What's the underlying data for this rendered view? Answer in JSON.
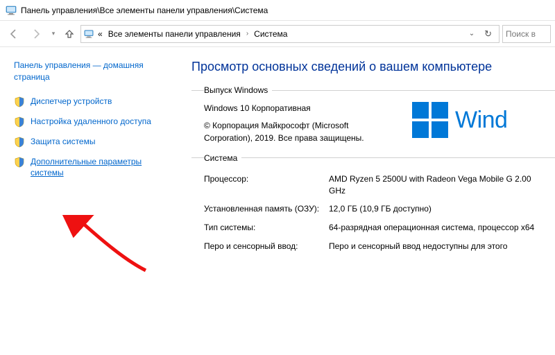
{
  "titlebar": {
    "text": "Панель управления\\Все элементы панели управления\\Система"
  },
  "address": {
    "prefix": "«",
    "crumb1": "Все элементы панели управления",
    "crumb2": "Система"
  },
  "search": {
    "placeholder": "Поиск в"
  },
  "sidebar": {
    "home_label": "Панель управления — домашняя страница",
    "items": [
      {
        "label": "Диспетчер устройств"
      },
      {
        "label": "Настройка удаленного доступа"
      },
      {
        "label": "Защита системы"
      },
      {
        "label": "Дополнительные параметры системы"
      }
    ]
  },
  "main": {
    "heading": "Просмотр основных сведений о вашем компьютере",
    "windows_group_legend": "Выпуск Windows",
    "edition": "Windows 10 Корпоративная",
    "copyright": "© Корпорация Майкрософт (Microsoft Corporation), 2019. Все права защищены.",
    "logo_word": "Wind",
    "system_group_legend": "Система",
    "rows": {
      "cpu_key": "Процессор:",
      "cpu_val": "AMD Ryzen 5 2500U with Radeon Vega Mobile G  2.00 GHz",
      "ram_key": "Установленная память (ОЗУ):",
      "ram_val": "12,0 ГБ (10,9 ГБ доступно)",
      "type_key": "Тип системы:",
      "type_val": "64-разрядная операционная система, процессор x64",
      "pen_key": "Перо и сенсорный ввод:",
      "pen_val": "Перо и сенсорный ввод недоступны для этого"
    }
  }
}
